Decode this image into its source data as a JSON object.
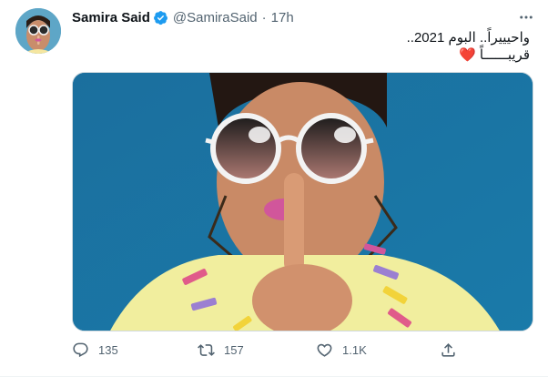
{
  "tweet": {
    "author": {
      "display_name": "Samira Said",
      "handle": "@SamiraSaid",
      "verified": true
    },
    "separator": "·",
    "timestamp": "17h",
    "text_lines": [
      "واحيييراً.. البوم 2021..",
      "قريبــــــاً"
    ],
    "heart": "❤️",
    "actions": {
      "reply_count": "135",
      "retweet_count": "157",
      "like_count": "1.1K"
    }
  },
  "icons": {
    "verified": "verified-badge-icon",
    "more": "more-options-icon",
    "reply": "reply-icon",
    "retweet": "retweet-icon",
    "like": "heart-icon",
    "share": "share-icon"
  },
  "colors": {
    "accent": "#1d9bf0",
    "text_secondary": "#536471",
    "heart_emoji": "#e0245e",
    "media_background": "#1f77a6"
  }
}
